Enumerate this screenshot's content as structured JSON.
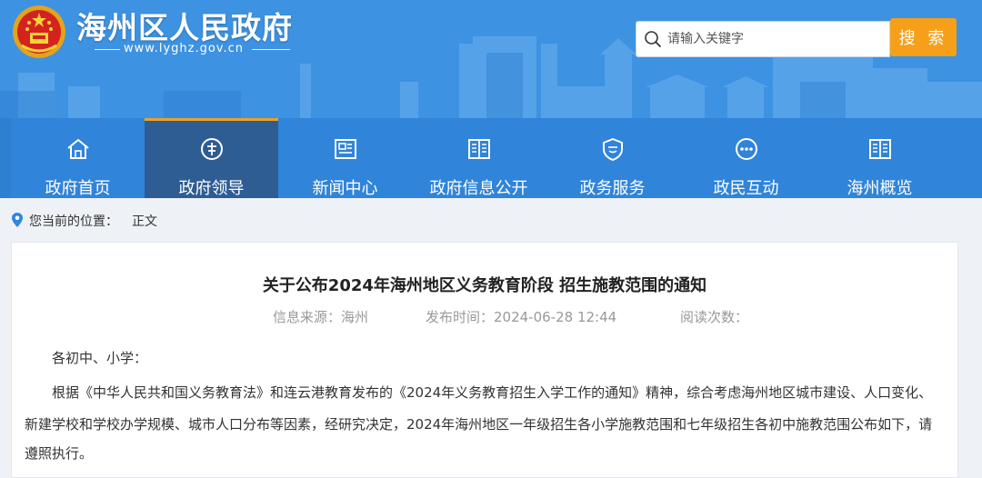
{
  "header": {
    "site_title": "海州区人民政府",
    "site_url": "www.lyghz.gov.cn",
    "search_placeholder": "请输入关键字",
    "search_button": "搜 索"
  },
  "nav": {
    "items": [
      {
        "label": "政府首页",
        "icon": "home-icon"
      },
      {
        "label": "政府领导",
        "icon": "leader-icon"
      },
      {
        "label": "新闻中心",
        "icon": "news-icon"
      },
      {
        "label": "政府信息公开",
        "icon": "book-icon"
      },
      {
        "label": "政务服务",
        "icon": "shield-icon"
      },
      {
        "label": "政民互动",
        "icon": "chat-icon"
      },
      {
        "label": "海州概览",
        "icon": "book-icon"
      }
    ],
    "active_index": 1
  },
  "breadcrumb": {
    "label": "您当前的位置：",
    "current": "正文"
  },
  "article": {
    "title": "关于公布2024年海州地区义务教育阶段 招生施教范围的通知",
    "source": "信息来源：海州",
    "publish_time": "发布时间：2024-06-28 12:44",
    "read_count": "阅读次数：",
    "greeting": "各初中、小学：",
    "line1": "根据《中华人民共和国义务教育法》和连云港教育发布的《2024年义务教育招生入学工作的通知》精神，综合考虑海州地区城市建设、人口变化、",
    "line2": "新建学校和学校办学规模、城市人口分布等因素，经研究决定，2024年海州地区一年级招生各小学施教范围和七年级招生各初中施教范围公布如下，请",
    "line3": "遵照执行。"
  },
  "colors": {
    "header_blue": "#3d92e2",
    "nav_blue": "#3084d9",
    "nav_active": "#2e5d93",
    "accent_orange": "#f6a01a"
  }
}
